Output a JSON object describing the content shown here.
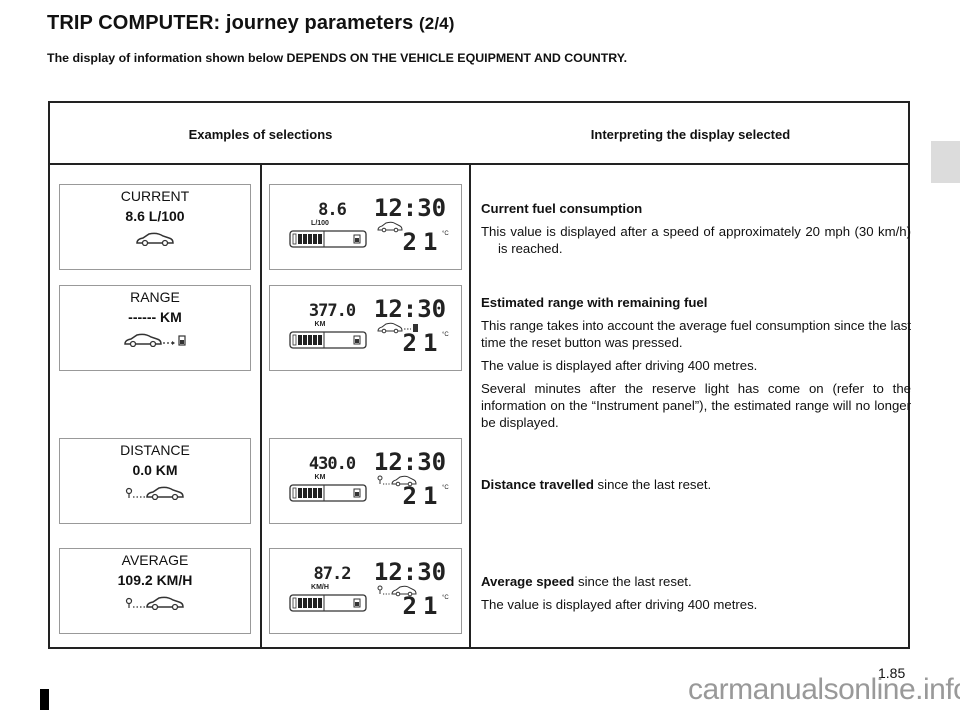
{
  "header": {
    "title": "TRIP COMPUTER: journey parameters",
    "page_indicator": "(2/4)",
    "subtitle": "The display of information shown below DEPENDS ON THE VEHICLE EQUIPMENT AND COUNTRY."
  },
  "table": {
    "columns": [
      "Examples of selections",
      "Interpreting the display selected"
    ],
    "rows": [
      {
        "selection_label": "CURRENT",
        "selection_value": "8.6 L/100",
        "selection_icon": "car-icon",
        "display": {
          "main_value": "8.6",
          "unit": "L/100",
          "clock": "12:30",
          "temperature": "21",
          "temp_unit": "°C",
          "mode_icon": "car-icon",
          "fuel_level": 0.5
        },
        "description_title": "Current fuel consumption",
        "description": [
          "This value is displayed after a speed of approximately 20 mph (30 km/h) is reached."
        ]
      },
      {
        "selection_label": "RANGE",
        "selection_value": "------ KM",
        "selection_icon": "car-to-fuel-icon",
        "display": {
          "main_value": "377.0",
          "unit": "KM",
          "clock": "12:30",
          "temperature": "21",
          "temp_unit": "°C",
          "mode_icon": "car-to-fuel-icon",
          "fuel_level": 0.5
        },
        "description_title": "Estimated range with remaining fuel",
        "description": [
          "This range takes into account the average fuel consumption since the last time the reset button was pressed.",
          "The value is displayed after driving 400 metres.",
          "Several minutes after the reserve light has come on (refer to the information on the “Instrument panel”), the estimated range will no longer be displayed."
        ]
      },
      {
        "selection_label": "DISTANCE",
        "selection_value": "0.0 KM",
        "selection_icon": "start-to-car-icon",
        "display": {
          "main_value": "430.0",
          "unit": "KM",
          "clock": "12:30",
          "temperature": "21",
          "temp_unit": "°C",
          "mode_icon": "start-to-car-icon",
          "fuel_level": 0.5
        },
        "description_title": "Distance travelled",
        "description_rest": " since the last reset.",
        "description": []
      },
      {
        "selection_label": "AVERAGE",
        "selection_value": "109.2 KM/H",
        "selection_icon": "start-to-car-icon",
        "display": {
          "main_value": "87.2",
          "unit": "KM/H",
          "clock": "12:30",
          "temperature": "21",
          "temp_unit": "°C",
          "mode_icon": "start-to-car-icon",
          "fuel_level": 0.5
        },
        "description_title": "Average speed",
        "description_rest": " since the last reset.",
        "description": [
          "The value is displayed after driving 400 metres."
        ]
      }
    ]
  },
  "footer": {
    "page_number": "1.85",
    "watermark": "carmanualsonline.info"
  }
}
